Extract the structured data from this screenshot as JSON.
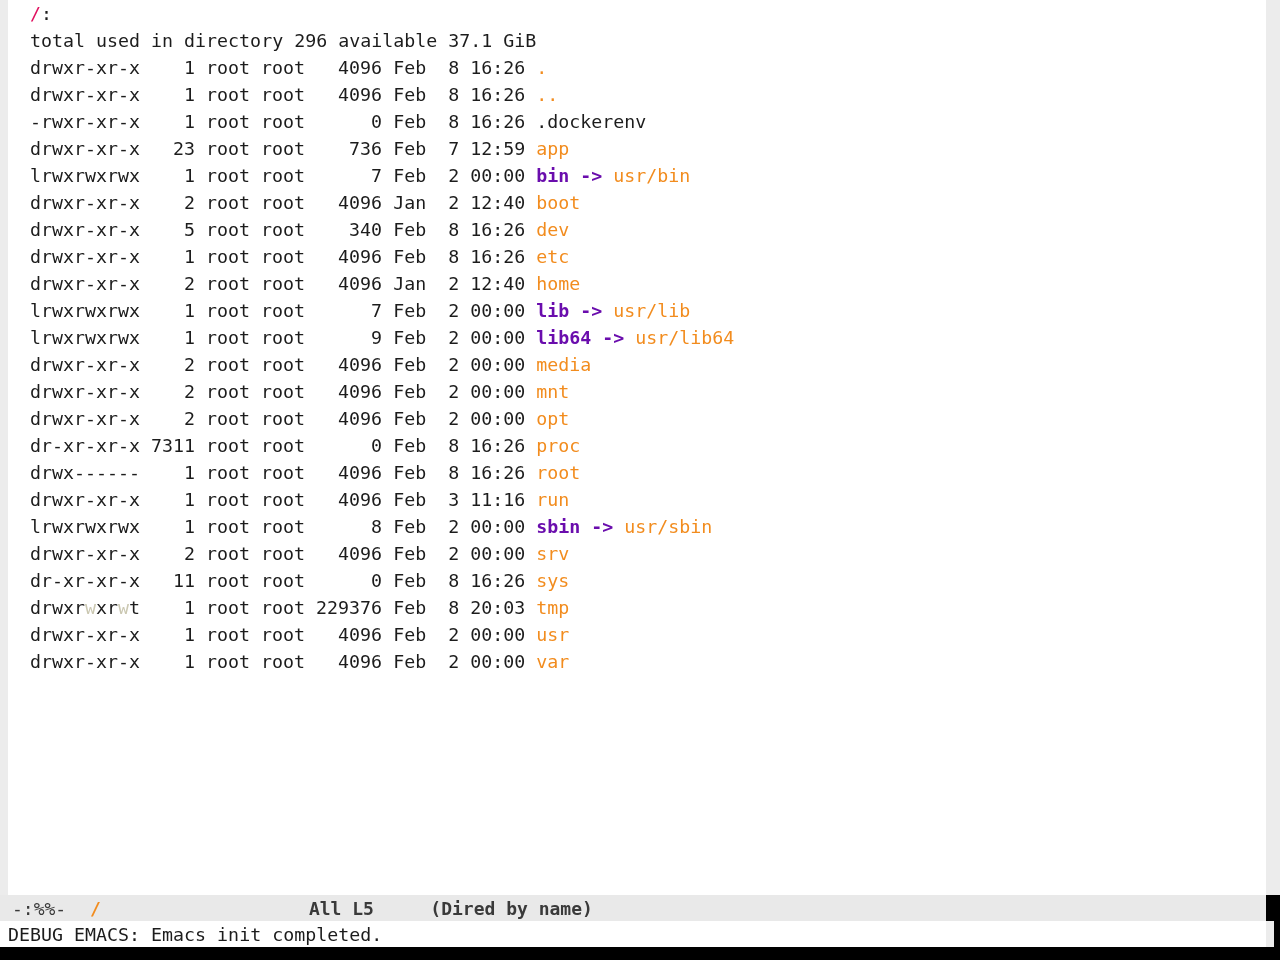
{
  "header": {
    "path": "/",
    "suffix": ":"
  },
  "summary": "total used in directory 296 available 37.1 GiB",
  "entries": [
    {
      "permissions": [
        {
          "text": "drwxr-xr-x",
          "highlighted": false
        }
      ],
      "links": "1",
      "owner": "root",
      "group": "root",
      "size": "4096",
      "month": "Feb",
      "day": "8",
      "time": "16:26",
      "name": ".",
      "kind": "directory"
    },
    {
      "permissions": [
        {
          "text": "drwxr-xr-x",
          "highlighted": false
        }
      ],
      "links": "1",
      "owner": "root",
      "group": "root",
      "size": "4096",
      "month": "Feb",
      "day": "8",
      "time": "16:26",
      "name": "..",
      "kind": "directory"
    },
    {
      "permissions": [
        {
          "text": "-rwxr-xr-x",
          "highlighted": false
        }
      ],
      "links": "1",
      "owner": "root",
      "group": "root",
      "size": "0",
      "month": "Feb",
      "day": "8",
      "time": "16:26",
      "name": ".dockerenv",
      "kind": "file"
    },
    {
      "permissions": [
        {
          "text": "drwxr-xr-x",
          "highlighted": false
        }
      ],
      "links": "23",
      "owner": "root",
      "group": "root",
      "size": "736",
      "month": "Feb",
      "day": "7",
      "time": "12:59",
      "name": "app",
      "kind": "directory"
    },
    {
      "permissions": [
        {
          "text": "lrwxrwxrwx",
          "highlighted": false
        }
      ],
      "links": "1",
      "owner": "root",
      "group": "root",
      "size": "7",
      "month": "Feb",
      "day": "2",
      "time": "00:00",
      "name": "bin",
      "kind": "symlink",
      "arrow": "->",
      "target": "usr/bin"
    },
    {
      "permissions": [
        {
          "text": "drwxr-xr-x",
          "highlighted": false
        }
      ],
      "links": "2",
      "owner": "root",
      "group": "root",
      "size": "4096",
      "month": "Jan",
      "day": "2",
      "time": "12:40",
      "name": "boot",
      "kind": "directory"
    },
    {
      "permissions": [
        {
          "text": "drwxr-xr-x",
          "highlighted": false
        }
      ],
      "links": "5",
      "owner": "root",
      "group": "root",
      "size": "340",
      "month": "Feb",
      "day": "8",
      "time": "16:26",
      "name": "dev",
      "kind": "directory"
    },
    {
      "permissions": [
        {
          "text": "drwxr-xr-x",
          "highlighted": false
        }
      ],
      "links": "1",
      "owner": "root",
      "group": "root",
      "size": "4096",
      "month": "Feb",
      "day": "8",
      "time": "16:26",
      "name": "etc",
      "kind": "directory"
    },
    {
      "permissions": [
        {
          "text": "drwxr-xr-x",
          "highlighted": false
        }
      ],
      "links": "2",
      "owner": "root",
      "group": "root",
      "size": "4096",
      "month": "Jan",
      "day": "2",
      "time": "12:40",
      "name": "home",
      "kind": "directory"
    },
    {
      "permissions": [
        {
          "text": "lrwxrwxrwx",
          "highlighted": false
        }
      ],
      "links": "1",
      "owner": "root",
      "group": "root",
      "size": "7",
      "month": "Feb",
      "day": "2",
      "time": "00:00",
      "name": "lib",
      "kind": "symlink",
      "arrow": "->",
      "target": "usr/lib"
    },
    {
      "permissions": [
        {
          "text": "lrwxrwxrwx",
          "highlighted": false
        }
      ],
      "links": "1",
      "owner": "root",
      "group": "root",
      "size": "9",
      "month": "Feb",
      "day": "2",
      "time": "00:00",
      "name": "lib64",
      "kind": "symlink",
      "arrow": "->",
      "target": "usr/lib64"
    },
    {
      "permissions": [
        {
          "text": "drwxr-xr-x",
          "highlighted": false
        }
      ],
      "links": "2",
      "owner": "root",
      "group": "root",
      "size": "4096",
      "month": "Feb",
      "day": "2",
      "time": "00:00",
      "name": "media",
      "kind": "directory"
    },
    {
      "permissions": [
        {
          "text": "drwxr-xr-x",
          "highlighted": false
        }
      ],
      "links": "2",
      "owner": "root",
      "group": "root",
      "size": "4096",
      "month": "Feb",
      "day": "2",
      "time": "00:00",
      "name": "mnt",
      "kind": "directory"
    },
    {
      "permissions": [
        {
          "text": "drwxr-xr-x",
          "highlighted": false
        }
      ],
      "links": "2",
      "owner": "root",
      "group": "root",
      "size": "4096",
      "month": "Feb",
      "day": "2",
      "time": "00:00",
      "name": "opt",
      "kind": "directory"
    },
    {
      "permissions": [
        {
          "text": "dr-xr-xr-x",
          "highlighted": false
        }
      ],
      "links": "7311",
      "owner": "root",
      "group": "root",
      "size": "0",
      "month": "Feb",
      "day": "8",
      "time": "16:26",
      "name": "proc",
      "kind": "directory"
    },
    {
      "permissions": [
        {
          "text": "drwx------",
          "highlighted": false
        }
      ],
      "links": "1",
      "owner": "root",
      "group": "root",
      "size": "4096",
      "month": "Feb",
      "day": "8",
      "time": "16:26",
      "name": "root",
      "kind": "directory"
    },
    {
      "permissions": [
        {
          "text": "drwxr-xr-x",
          "highlighted": false
        }
      ],
      "links": "1",
      "owner": "root",
      "group": "root",
      "size": "4096",
      "month": "Feb",
      "day": "3",
      "time": "11:16",
      "name": "run",
      "kind": "directory"
    },
    {
      "permissions": [
        {
          "text": "lrwxrwxrwx",
          "highlighted": false
        }
      ],
      "links": "1",
      "owner": "root",
      "group": "root",
      "size": "8",
      "month": "Feb",
      "day": "2",
      "time": "00:00",
      "name": "sbin",
      "kind": "symlink",
      "arrow": "->",
      "target": "usr/sbin"
    },
    {
      "permissions": [
        {
          "text": "drwxr-xr-x",
          "highlighted": false
        }
      ],
      "links": "2",
      "owner": "root",
      "group": "root",
      "size": "4096",
      "month": "Feb",
      "day": "2",
      "time": "00:00",
      "name": "srv",
      "kind": "directory"
    },
    {
      "permissions": [
        {
          "text": "dr-xr-xr-x",
          "highlighted": false
        }
      ],
      "links": "11",
      "owner": "root",
      "group": "root",
      "size": "0",
      "month": "Feb",
      "day": "8",
      "time": "16:26",
      "name": "sys",
      "kind": "directory"
    },
    {
      "permissions": [
        {
          "text": "drwxr",
          "highlighted": false
        },
        {
          "text": "w",
          "highlighted": true
        },
        {
          "text": "xr",
          "highlighted": false
        },
        {
          "text": "w",
          "highlighted": true
        },
        {
          "text": "t",
          "highlighted": false
        }
      ],
      "links": "1",
      "owner": "root",
      "group": "root",
      "size": "229376",
      "month": "Feb",
      "day": "8",
      "time": "20:03",
      "name": "tmp",
      "kind": "directory"
    },
    {
      "permissions": [
        {
          "text": "drwxr-xr-x",
          "highlighted": false
        }
      ],
      "links": "1",
      "owner": "root",
      "group": "root",
      "size": "4096",
      "month": "Feb",
      "day": "2",
      "time": "00:00",
      "name": "usr",
      "kind": "directory"
    },
    {
      "permissions": [
        {
          "text": "drwxr-xr-x",
          "highlighted": false
        }
      ],
      "links": "1",
      "owner": "root",
      "group": "root",
      "size": "4096",
      "month": "Feb",
      "day": "2",
      "time": "00:00",
      "name": "var",
      "kind": "directory"
    }
  ],
  "mode_line": {
    "status": "-:%%-",
    "buffer_name": "/",
    "position": "All",
    "line": "L5",
    "modes": "(Dired by name)"
  },
  "echo_area": {
    "message": "DEBUG EMACS: Emacs init completed."
  }
}
